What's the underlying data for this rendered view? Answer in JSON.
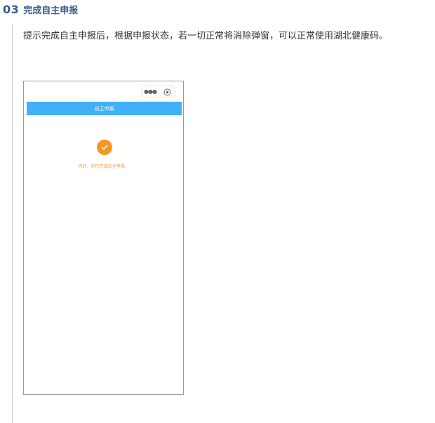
{
  "section": {
    "number": "03",
    "title": "完成自主申报"
  },
  "intro": {
    "text": "提示完成自主申报后，根据申报状态，若一切正常将消除弹窗，可以正常使用湖北健康码。"
  },
  "phone": {
    "capsule": {
      "more_icon": "more-dots-icon",
      "close_icon": "circle-close-icon"
    },
    "nav": {
      "title": "自主申报",
      "color": "#42b0f8"
    },
    "status": {
      "icon": "checkmark-icon",
      "icon_color": "#f7971e",
      "message": "你好，你已完成自主申报。"
    }
  }
}
